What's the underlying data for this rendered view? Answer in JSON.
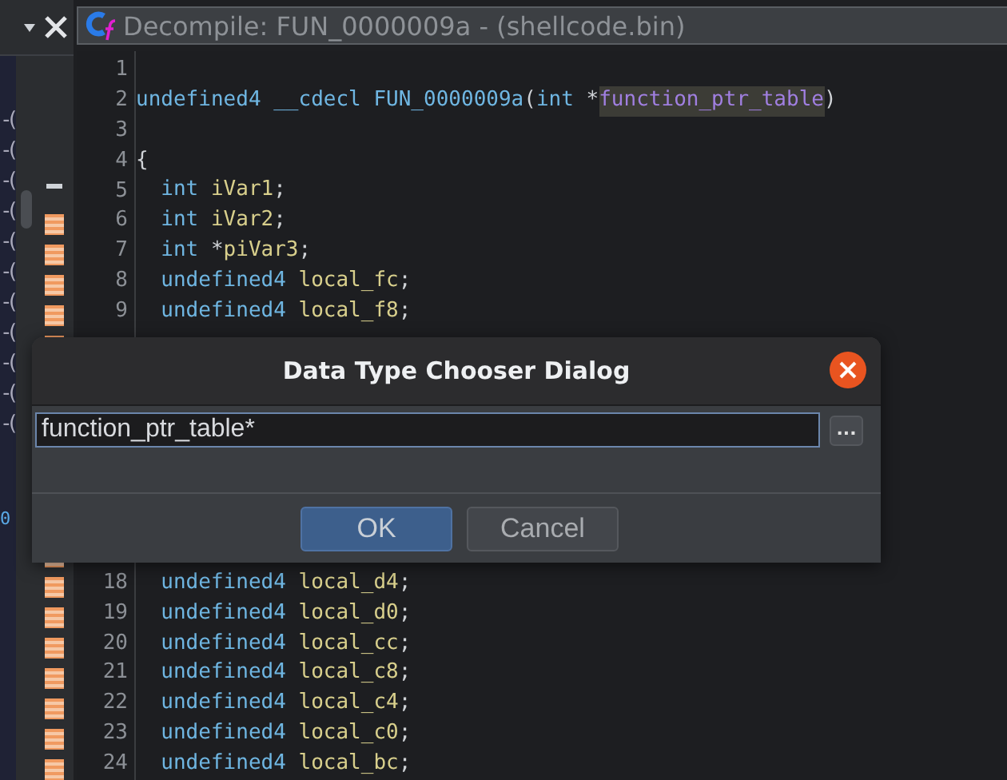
{
  "left_panel": {
    "rows": [
      "-(",
      "-(",
      "-(",
      "-(",
      "-(",
      "-(",
      "-(",
      "-(",
      "-(",
      "-(",
      "-("
    ],
    "tail": "0"
  },
  "decompile": {
    "title": "Decompile: FUN_0000009a -  (shellcode.bin)",
    "lines": [
      {
        "number": "1"
      },
      {
        "number": "2",
        "tokens": [
          {
            "text": "undefined4 __cdecl FUN_0000009a",
            "kind": "keyword"
          },
          {
            "text": "(",
            "kind": "plain"
          },
          {
            "text": "int",
            "kind": "keyword"
          },
          {
            "text": " *",
            "kind": "plain"
          },
          {
            "text": "function_ptr_table",
            "kind": "highlight"
          },
          {
            "text": ")",
            "kind": "plain"
          }
        ]
      },
      {
        "number": "3"
      },
      {
        "number": "4",
        "tokens": [
          {
            "text": "{",
            "kind": "plain"
          }
        ]
      },
      {
        "number": "5",
        "tokens": [
          {
            "text": "  int ",
            "kind": "keyword"
          },
          {
            "text": "iVar1",
            "kind": "variable"
          },
          {
            "text": ";",
            "kind": "plain"
          }
        ]
      },
      {
        "number": "6",
        "tokens": [
          {
            "text": "  int ",
            "kind": "keyword"
          },
          {
            "text": "iVar2",
            "kind": "variable"
          },
          {
            "text": ";",
            "kind": "plain"
          }
        ]
      },
      {
        "number": "7",
        "tokens": [
          {
            "text": "  int",
            "kind": "keyword"
          },
          {
            "text": " *",
            "kind": "plain"
          },
          {
            "text": "piVar3",
            "kind": "variable"
          },
          {
            "text": ";",
            "kind": "plain"
          }
        ]
      },
      {
        "number": "8",
        "tokens": [
          {
            "text": "  undefined4 ",
            "kind": "keyword"
          },
          {
            "text": "local_fc",
            "kind": "variable"
          },
          {
            "text": ";",
            "kind": "plain"
          }
        ]
      },
      {
        "number": "9",
        "tokens": [
          {
            "text": "  undefined4 ",
            "kind": "keyword"
          },
          {
            "text": "local_f8",
            "kind": "variable"
          },
          {
            "text": ";",
            "kind": "plain"
          }
        ]
      },
      {
        "number": "18",
        "tokens": [
          {
            "text": "  undefined4 ",
            "kind": "keyword"
          },
          {
            "text": "local_d4",
            "kind": "variable"
          },
          {
            "text": ";",
            "kind": "plain"
          }
        ]
      },
      {
        "number": "19",
        "tokens": [
          {
            "text": "  undefined4 ",
            "kind": "keyword"
          },
          {
            "text": "local_d0",
            "kind": "variable"
          },
          {
            "text": ";",
            "kind": "plain"
          }
        ]
      },
      {
        "number": "20",
        "tokens": [
          {
            "text": "  undefined4 ",
            "kind": "keyword"
          },
          {
            "text": "local_cc",
            "kind": "variable"
          },
          {
            "text": ";",
            "kind": "plain"
          }
        ]
      },
      {
        "number": "21",
        "tokens": [
          {
            "text": "  undefined4 ",
            "kind": "keyword"
          },
          {
            "text": "local_c8",
            "kind": "variable"
          },
          {
            "text": ";",
            "kind": "plain"
          }
        ]
      },
      {
        "number": "22",
        "tokens": [
          {
            "text": "  undefined4 ",
            "kind": "keyword"
          },
          {
            "text": "local_c4",
            "kind": "variable"
          },
          {
            "text": ";",
            "kind": "plain"
          }
        ]
      },
      {
        "number": "23",
        "tokens": [
          {
            "text": "  undefined4 ",
            "kind": "keyword"
          },
          {
            "text": "local_c0",
            "kind": "variable"
          },
          {
            "text": ";",
            "kind": "plain"
          }
        ]
      },
      {
        "number": "24",
        "tokens": [
          {
            "text": "  undefined4 ",
            "kind": "keyword"
          },
          {
            "text": "local_bc",
            "kind": "variable"
          },
          {
            "text": ";",
            "kind": "plain"
          }
        ]
      }
    ]
  },
  "dialog": {
    "title": "Data Type Chooser Dialog",
    "field": {
      "value": "function_ptr_table*"
    },
    "browse_button": "...",
    "buttons": [
      {
        "label": "OK",
        "selected": true
      },
      {
        "label": "Cancel",
        "selected": false
      }
    ]
  }
}
